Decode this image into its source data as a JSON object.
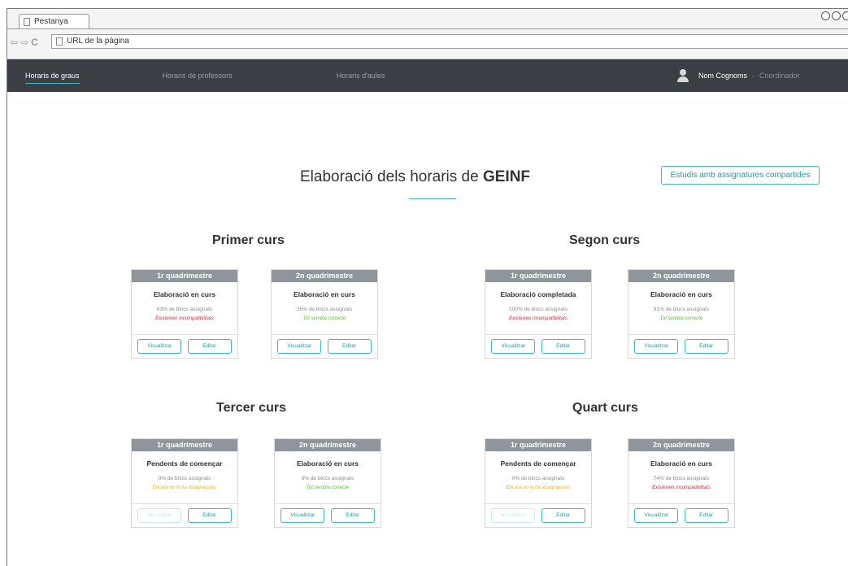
{
  "browser": {
    "tab_title": "Pestanya",
    "url": "URL de la pàgina",
    "nav_buttons": [
      "back",
      "forward",
      "reload"
    ]
  },
  "appbar": {
    "nav": [
      {
        "label": "Horaris de graus",
        "active": true
      },
      {
        "label": "Horaris de professors",
        "active": false
      },
      {
        "label": "Horaris d'aules",
        "active": false
      }
    ],
    "user": {
      "icon": "user-icon",
      "name": "Nom Cognoms",
      "separator": "-",
      "role": "Coordinador"
    }
  },
  "main": {
    "title_prefix": "Elaboració dels horaris de",
    "title_degree": "GEINF",
    "shared_button": "Estudis amb assignatures compartides",
    "courses": [
      {
        "title": "Primer curs",
        "terms": [
          {
            "header": "1r quadrimestre",
            "state": "Elaboració en curs",
            "progress": "63% de blocs assignats",
            "message": "Existeixen incompatibilitats",
            "message_color": "#e02a3c",
            "view_label": "Visualitzar",
            "edit_label": "Editar",
            "view_enabled": true
          },
          {
            "header": "2n quadrimestre",
            "state": "Elaboració en curs",
            "progress": "26% de blocs assignats",
            "message": "Tot sembla correcte",
            "message_color": "#5bbd3a",
            "view_label": "Visualitzar",
            "edit_label": "Editar",
            "view_enabled": true
          }
        ]
      },
      {
        "title": "Segon curs",
        "terms": [
          {
            "header": "1r quadrimestre",
            "state": "Elaboració completada",
            "progress": "100% de blocs assignats",
            "message": "Existeixen incompatibilitats",
            "message_color": "#e02a3c",
            "view_label": "Visualitzar",
            "edit_label": "Editar",
            "view_enabled": true
          },
          {
            "header": "2n quadrimestre",
            "state": "Elaboració en curs",
            "progress": "91% de blocs assignats",
            "message": "Tot sembla correcte",
            "message_color": "#5bbd3a",
            "view_label": "Visualitzar",
            "edit_label": "Editar",
            "view_enabled": true
          }
        ]
      },
      {
        "title": "Tercer curs",
        "terms": [
          {
            "header": "1r quadrimestre",
            "state": "Pendents de començar",
            "progress": "0% de blocs assignats",
            "message": "Encara no hi ha assignacions",
            "message_color": "#e9b21f",
            "view_label": "Visualitzar",
            "edit_label": "Editar",
            "view_enabled": false
          },
          {
            "header": "2n quadrimestre",
            "state": "Elaboració en curs",
            "progress": "3% de blocs assignats",
            "message": "Tot sembla correcte",
            "message_color": "#5bbd3a",
            "view_label": "Visualitzar",
            "edit_label": "Editar",
            "view_enabled": true
          }
        ]
      },
      {
        "title": "Quart curs",
        "terms": [
          {
            "header": "1r quadrimestre",
            "state": "Pendents de començar",
            "progress": "0% de blocs assignats",
            "message": "Encara no hi ha assignacions",
            "message_color": "#e9b21f",
            "view_label": "Visualitzar",
            "edit_label": "Editar",
            "view_enabled": false
          },
          {
            "header": "2n quadrimestre",
            "state": "Elaboració en curs",
            "progress": "74% de blocs assignats",
            "message": "Existeixen incompatibilitats",
            "message_color": "#e02a3c",
            "view_label": "Visualitzar",
            "edit_label": "Editar",
            "view_enabled": true
          }
        ]
      }
    ]
  }
}
